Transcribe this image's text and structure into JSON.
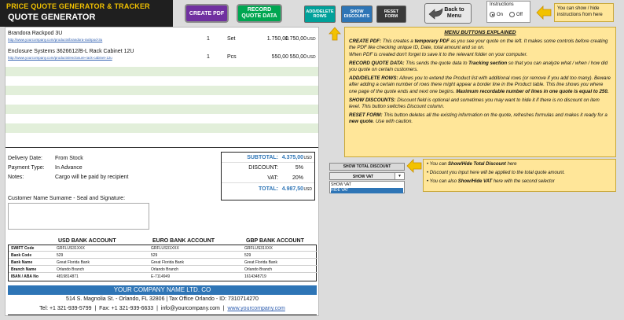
{
  "header": {
    "app_title": "PRICE QUOTE GENERATOR & TRACKER",
    "sheet_title": "QUOTE GENERATOR"
  },
  "toolbar": {
    "create_pdf": "CREATE PDF",
    "record_quote_data": "RECORD QUOTE DATA",
    "add_delete_rows": "ADD/DELETE ROWS",
    "show_discounts": "SHOW DISCOUNTS",
    "reset_form": "RESET FORM",
    "back_to_menu": "Back to Menu"
  },
  "instructions": {
    "label": "Instructions",
    "on": "On",
    "off": "Off",
    "selected": "On",
    "tip": "You can show / hide instructions from here"
  },
  "products": [
    {
      "name": "Brandora Rackpod 3U",
      "link": "http://www.yourcompany.com/products/brandora-rackpod-3u",
      "qty": "1",
      "unit": "Set",
      "price": "1.750,00",
      "total": "1.750,00",
      "currency": "USD"
    },
    {
      "name": "Enclosure Systems 3626612/B-L Rack Cabinet 12U",
      "link": "http://www.yourcompany.com/products/enclosure-rack-cabinet-12u",
      "qty": "1",
      "unit": "Pcs",
      "price": "550,00",
      "total": "550,00",
      "currency": "USD"
    }
  ],
  "terms": {
    "delivery_label": "Delivery Date:",
    "delivery_value": "From Stock",
    "payment_label": "Payment Type:",
    "payment_value": "In Advance",
    "notes_label": "Notes:",
    "notes_value": "Cargo will be paid by recipient"
  },
  "totals": {
    "subtotal_label": "SUBTOTAL:",
    "subtotal_value": "4.375,00",
    "discount_label": "DISCOUNT:",
    "discount_value": "5%",
    "vat_label": "VAT:",
    "vat_value": "20%",
    "total_label": "TOTAL:",
    "total_value": "4.987,50",
    "currency": "USD"
  },
  "signature_label": "Customer Name Surname - Seal and Signature:",
  "bank": {
    "headers": [
      "USD BANK ACCOUNT",
      "EURO BANK ACCOUNT",
      "GBP BANK ACCOUNT"
    ],
    "rows": [
      {
        "label": "SWIFT Code",
        "values": [
          "GRFLUS31XXX",
          "GRFLUS31XXX",
          "GRFLUS31XXX"
        ]
      },
      {
        "label": "Bank Code",
        "values": [
          "529",
          "529",
          "529"
        ]
      },
      {
        "label": "Bank Name",
        "values": [
          "Great Florida Bank",
          "Great Florida Bank",
          "Great Florida Bank"
        ]
      },
      {
        "label": "Branch Name",
        "values": [
          "Orlando Branch",
          "Orlando Branch",
          "Orlando Branch"
        ]
      },
      {
        "label": "IBAN / ABA No",
        "values": [
          "4819814871",
          "E-7114949",
          "1614348719"
        ]
      }
    ]
  },
  "footer": {
    "company": "YOUR COMPANY NAME LTD. CO",
    "address": "514 S. Magnolia St. - Orlando, FL 32806  |  Tax Office Orlando - ID: 7310714270",
    "tel": "Tel: +1 321-939-5799",
    "fax": "Fax: +1 321-939-6633",
    "email": "info@yourcompany.com",
    "web": "www.yourcompany.com"
  },
  "explain": {
    "title": "MENU BUTTONS EXPLAINED",
    "create_pdf_head": "CREATE PDF:",
    "create_pdf_a": " This creates a ",
    "create_pdf_b": "temporary PDF",
    "create_pdf_c": " as you see your quote on the left. It makes some controls before creating the PDF like checking unique ID, Date, total amount and so on.",
    "create_pdf_d": "When PDF is created don't forget to save it to the relevant folder on your computer.",
    "record_head": "RECORD QUOTE DATA:",
    "record_a": " This sends the quote data to ",
    "record_b": "Tracking section",
    "record_c": " so that you can analyze what / when / how did you quote on certain customers.",
    "add_head": "ADD/DELETE ROWS:",
    "add_a": " Allows you to extend the Product list with additional rows (or remove if you add too many). Beware after adding a certain number of rows there might appear a border line in the Product table. This line shows you where one page of the quote ends and next one begins. ",
    "add_b": "Maximum recordable number of lines in one quote is equal to 250.",
    "disc_head": "SHOW DISCOUNTS:",
    "disc_a": " Discount field is optional and sometimes you may want to hide it if there is no discount on item level. This button switches Discount column.",
    "reset_head": "RESET FORM:",
    "reset_a": " This button deletes all the existing information on the quote, refreshes formulas and makes it ready for a ",
    "reset_b": "new quote",
    "reset_c": ". Use with caution."
  },
  "vat_controls": {
    "show_total_discount": "SHOW TOTAL DISCOUNT",
    "selected": "SHOW VAT",
    "options": [
      "SHOW VAT",
      "HIDE VAT"
    ]
  },
  "tips2": {
    "t1a": "You can ",
    "t1b": "Show/Hide Total Discount",
    "t1c": " here",
    "t2": "Discount you input here will be applied to the total quote amount.",
    "t3a": "You can also ",
    "t3b": "Show/Hide VAT",
    "t3c": " here with the second selector"
  },
  "colors": {
    "create_pdf": "#7030a0",
    "record": "#00a651",
    "add_rows": "#00a19a",
    "show_discounts": "#2e75b6",
    "reset": "#3a3a3a",
    "note_yellow": "#ffe699",
    "accent_blue": "#2e75b6"
  },
  "icons": [
    "back-arrow-icon",
    "tip-arrow-icon",
    "chevron-down-icon"
  ]
}
